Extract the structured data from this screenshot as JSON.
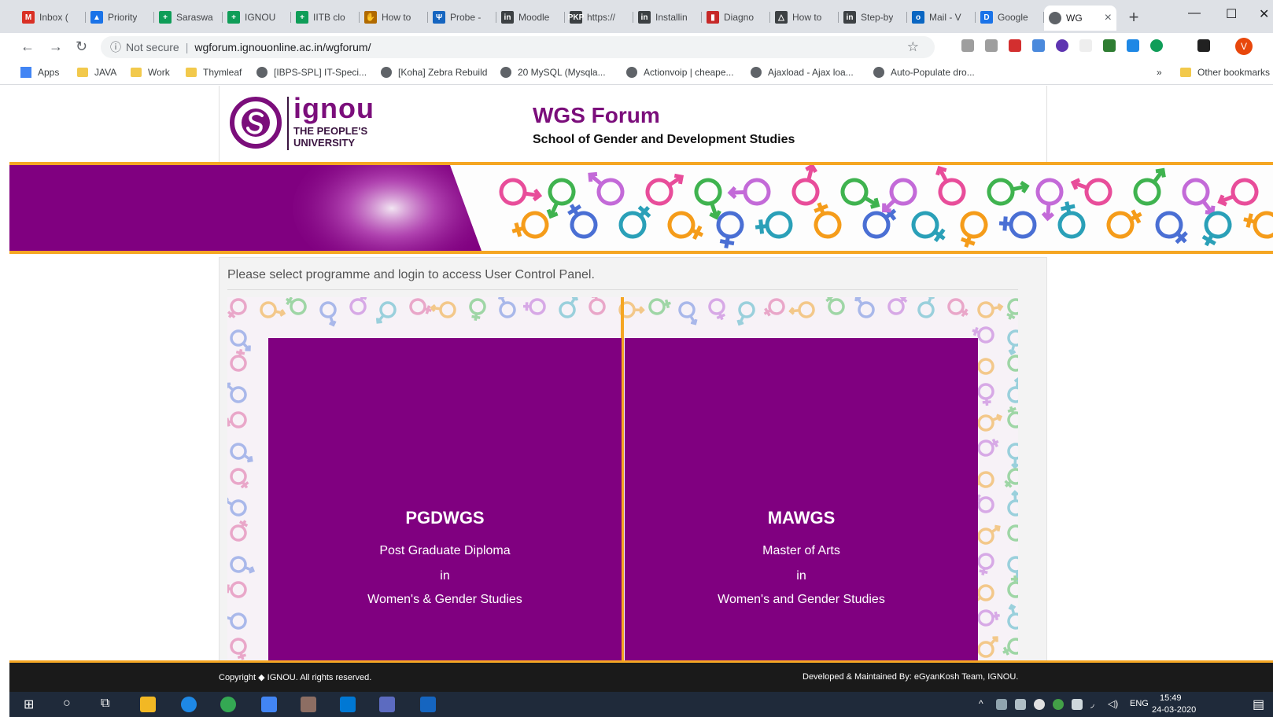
{
  "browser": {
    "tabs": [
      {
        "label": "Inbox (",
        "color": "#d93025",
        "glyph": "M"
      },
      {
        "label": "Priority",
        "color": "#1a73e8",
        "glyph": "▲"
      },
      {
        "label": "Saraswa",
        "color": "#0f9d58",
        "glyph": "+"
      },
      {
        "label": "IGNOU",
        "color": "#0f9d58",
        "glyph": "+"
      },
      {
        "label": "IITB clo",
        "color": "#0f9d58",
        "glyph": "+"
      },
      {
        "label": "How to",
        "color": "#b06a00",
        "glyph": "✋"
      },
      {
        "label": "Probe -",
        "color": "#1565c0",
        "glyph": "Ψ"
      },
      {
        "label": "Moodle",
        "color": "#3c4043",
        "glyph": "in"
      },
      {
        "label": "https://",
        "color": "#3c4043",
        "glyph": "PKP"
      },
      {
        "label": "Installin",
        "color": "#3c4043",
        "glyph": "in"
      },
      {
        "label": "Diagno",
        "color": "#c62828",
        "glyph": "▮"
      },
      {
        "label": "How to",
        "color": "#3c4043",
        "glyph": "△"
      },
      {
        "label": "Step-by",
        "color": "#3c4043",
        "glyph": "in"
      },
      {
        "label": "Mail - V",
        "color": "#0a66c2",
        "glyph": "o"
      },
      {
        "label": "Google",
        "color": "#1a73e8",
        "glyph": "D"
      }
    ],
    "active_tab": {
      "label": "WG",
      "close": "×"
    },
    "new_tab": "+",
    "security": "Not secure",
    "url": "wgforum.ignouonline.ac.in/wgforum/",
    "profile_initial": "V",
    "bookmarks": [
      {
        "label": "Apps",
        "kind": "apps"
      },
      {
        "label": "JAVA",
        "kind": "folder"
      },
      {
        "label": "Work",
        "kind": "folder"
      },
      {
        "label": "Thymleaf",
        "kind": "folder"
      },
      {
        "label": "[IBPS-SPL] IT-Speci...",
        "kind": "site"
      },
      {
        "label": "[Koha] Zebra Rebuild",
        "kind": "site"
      },
      {
        "label": "20 MySQL (Mysqla...",
        "kind": "site"
      },
      {
        "label": "Actionvoip | cheape...",
        "kind": "site"
      },
      {
        "label": "Ajaxload - Ajax loa...",
        "kind": "site"
      },
      {
        "label": "Auto-Populate dro...",
        "kind": "site"
      }
    ],
    "bookmarks_more": "»",
    "other_bookmarks": "Other bookmarks"
  },
  "site": {
    "logo_word": "ignou",
    "logo_line1": "THE PEOPLE'S",
    "logo_line2": "UNIVERSITY",
    "title": "WGS Forum",
    "subtitle": "School of Gender and Development Studies",
    "instruction": "Please select programme and login to access User Control Panel.",
    "programmes": [
      {
        "code": "PGDWGS",
        "line1": "Post Graduate Diploma",
        "line2": "in",
        "line3": "Women's & Gender Studies"
      },
      {
        "code": "MAWGS",
        "line1": "Master of Arts",
        "line2": "in",
        "line3": "Women's and Gender Studies"
      }
    ],
    "footer_left": "Copyright ◆ IGNOU. All rights reserved.",
    "footer_right": "Developed & Maintained By: eGyanKosh Team, IGNOU."
  },
  "taskbar": {
    "language": "ENG",
    "time": "15:49",
    "date": "24-03-2020"
  },
  "colors": {
    "brand_purple": "#800080",
    "accent_orange": "#f5a623"
  }
}
